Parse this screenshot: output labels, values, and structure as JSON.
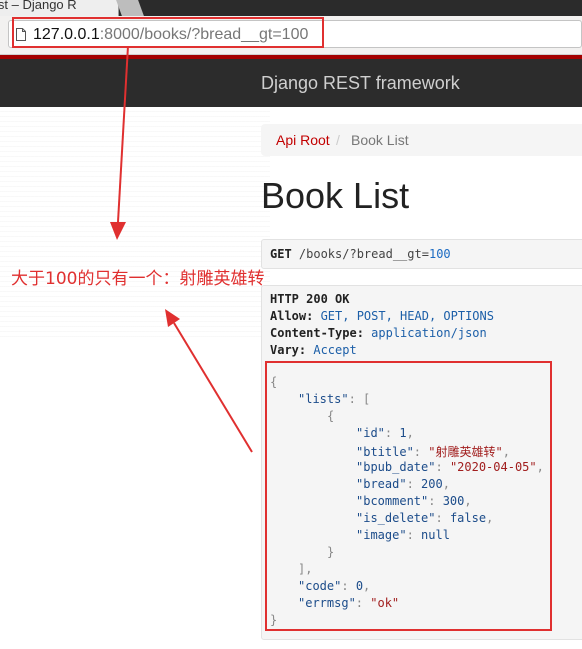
{
  "browser": {
    "tab_title": "ist – Django R",
    "url_host": "127.0.0.1",
    "url_rest": ":8000/books/?bread__gt=100"
  },
  "navbar": {
    "brand": "Django REST framework"
  },
  "breadcrumb": {
    "root": "Api Root",
    "separator": "/",
    "current": "Book List"
  },
  "page": {
    "title": "Book List"
  },
  "request": {
    "method": "GET",
    "path": " /books/?bread__gt=",
    "value": "100"
  },
  "response": {
    "status": "HTTP 200 OK",
    "allow_label": "Allow:",
    "allow_value": " GET, POST, HEAD, OPTIONS",
    "content_type_label": "Content-Type:",
    "content_type_value": " application/json",
    "vary_label": "Vary:",
    "vary_value": " Accept"
  },
  "json": {
    "open_brace": "{",
    "lists_key": "\"lists\"",
    "lists_open": ": [",
    "item_open": "{",
    "id_key": "\"id\"",
    "id_val": "1",
    "btitle_key": "\"btitle\"",
    "btitle_val": "\"射雕英雄转\"",
    "bpub_date_key": "\"bpub_date\"",
    "bpub_date_val": "\"2020-04-05\"",
    "bread_key": "\"bread\"",
    "bread_val": "200",
    "bcomment_key": "\"bcomment\"",
    "bcomment_val": "300",
    "is_delete_key": "\"is_delete\"",
    "is_delete_val": "false",
    "image_key": "\"image\"",
    "image_val": "null",
    "item_close": "}",
    "lists_close": "],",
    "code_key": "\"code\"",
    "code_val": "0",
    "errmsg_key": "\"errmsg\"",
    "errmsg_val": "\"ok\"",
    "close_brace": "}"
  },
  "annotation": {
    "text": "大于100的只有一个：射雕英雄转"
  },
  "colors": {
    "accent": "#a30000",
    "highlight": "#e03030",
    "link": "#c20000"
  },
  "icons": {
    "page": "page-icon"
  }
}
